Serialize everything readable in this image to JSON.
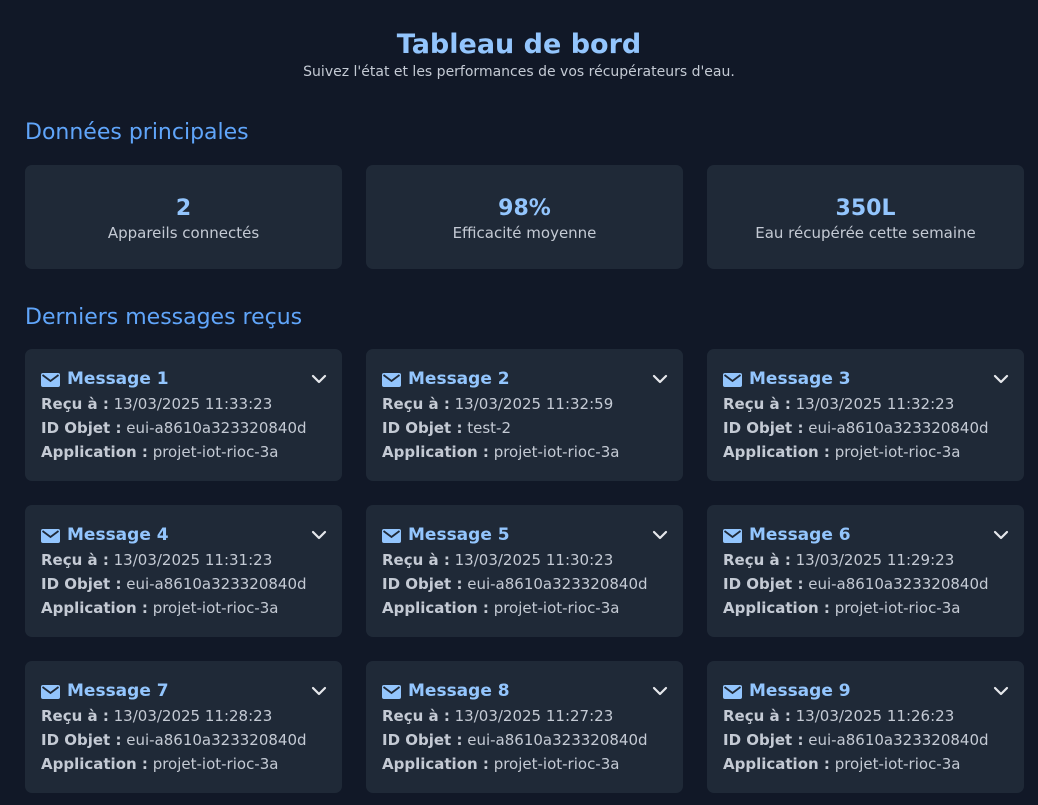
{
  "header": {
    "title": "Tableau de bord",
    "subtitle": "Suivez l'état et les performances de vos récupérateurs d'eau."
  },
  "sections": {
    "main": "Données principales",
    "messages": "Derniers messages reçus"
  },
  "stats": [
    {
      "value": "2",
      "label": "Appareils connectés"
    },
    {
      "value": "98%",
      "label": "Efficacité moyenne"
    },
    {
      "value": "350L",
      "label": "Eau récupérée cette semaine"
    }
  ],
  "field_labels": {
    "received": "Reçu à :",
    "object_id": "ID Objet :",
    "application": "Application :"
  },
  "messages": [
    {
      "title": "Message 1",
      "received": "13/03/2025 11:33:23",
      "object_id": "eui-a8610a323320840d",
      "application": "projet-iot-rioc-3a"
    },
    {
      "title": "Message 2",
      "received": "13/03/2025 11:32:59",
      "object_id": "test-2",
      "application": "projet-iot-rioc-3a"
    },
    {
      "title": "Message 3",
      "received": "13/03/2025 11:32:23",
      "object_id": "eui-a8610a323320840d",
      "application": "projet-iot-rioc-3a"
    },
    {
      "title": "Message 4",
      "received": "13/03/2025 11:31:23",
      "object_id": "eui-a8610a323320840d",
      "application": "projet-iot-rioc-3a"
    },
    {
      "title": "Message 5",
      "received": "13/03/2025 11:30:23",
      "object_id": "eui-a8610a323320840d",
      "application": "projet-iot-rioc-3a"
    },
    {
      "title": "Message 6",
      "received": "13/03/2025 11:29:23",
      "object_id": "eui-a8610a323320840d",
      "application": "projet-iot-rioc-3a"
    },
    {
      "title": "Message 7",
      "received": "13/03/2025 11:28:23",
      "object_id": "eui-a8610a323320840d",
      "application": "projet-iot-rioc-3a"
    },
    {
      "title": "Message 8",
      "received": "13/03/2025 11:27:23",
      "object_id": "eui-a8610a323320840d",
      "application": "projet-iot-rioc-3a"
    },
    {
      "title": "Message 9",
      "received": "13/03/2025 11:26:23",
      "object_id": "eui-a8610a323320840d",
      "application": "projet-iot-rioc-3a"
    }
  ],
  "icons": {
    "message": "envelope-icon",
    "expand": "chevron-down-icon"
  },
  "colors": {
    "background": "#111827",
    "card": "#1f2937",
    "accent": "#93c5fd",
    "section": "#60a5fa"
  }
}
